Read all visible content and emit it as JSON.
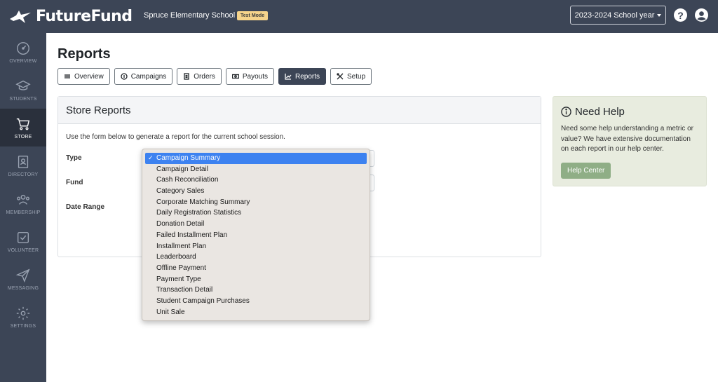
{
  "header": {
    "app_name": "FutureFund",
    "school_name": "Spruce Elementary School",
    "mode_badge": "Test Mode",
    "school_year": "2023-2024 School year",
    "help_symbol": "?"
  },
  "sidebar": {
    "items": [
      {
        "label": "OVERVIEW",
        "icon": "dashboard-gauge-icon"
      },
      {
        "label": "STUDENTS",
        "icon": "graduation-cap-icon"
      },
      {
        "label": "STORE",
        "icon": "shopping-cart-icon"
      },
      {
        "label": "DIRECTORY",
        "icon": "directory-book-icon"
      },
      {
        "label": "MEMBERSHIP",
        "icon": "people-group-icon"
      },
      {
        "label": "VOLUNTEER",
        "icon": "checkbox-icon"
      },
      {
        "label": "MESSAGING",
        "icon": "paper-plane-icon"
      },
      {
        "label": "SETTINGS",
        "icon": "gear-icon"
      }
    ]
  },
  "main": {
    "title": "Reports",
    "tabs": [
      {
        "label": "Overview",
        "icon": "list-icon"
      },
      {
        "label": "Campaigns",
        "icon": "coin-icon"
      },
      {
        "label": "Orders",
        "icon": "receipt-icon"
      },
      {
        "label": "Payouts",
        "icon": "money-icon"
      },
      {
        "label": "Reports",
        "icon": "line-chart-icon"
      },
      {
        "label": "Setup",
        "icon": "tools-icon"
      }
    ]
  },
  "report_card": {
    "title": "Store Reports",
    "description": "Use the form below to generate a report for the current school session.",
    "labels": {
      "type": "Type",
      "fund": "Fund",
      "date_range": "Date Range"
    }
  },
  "dropdown": {
    "check": "✓",
    "options": [
      "Campaign Summary",
      "Campaign Detail",
      "Cash Reconciliation",
      "Category Sales",
      "Corporate Matching Summary",
      "Daily Registration Statistics",
      "Donation Detail",
      "Failed Installment Plan",
      "Installment Plan",
      "Leaderboard",
      "Offline Payment",
      "Payment Type",
      "Transaction Detail",
      "Student Campaign Purchases",
      "Unit Sale"
    ],
    "selected": "Campaign Summary"
  },
  "help_card": {
    "title": "Need Help",
    "text": "Need some help understanding a metric or value? We have extensive documentation on each report in our help center.",
    "button": "Help Center"
  },
  "colors": {
    "nav_bg": "#3c4556",
    "active_bg": "#2a303c",
    "selected_option": "#3d82f0",
    "help_bg": "#e8ecdf",
    "help_button": "#8fae86",
    "badge": "#f5d38b"
  }
}
